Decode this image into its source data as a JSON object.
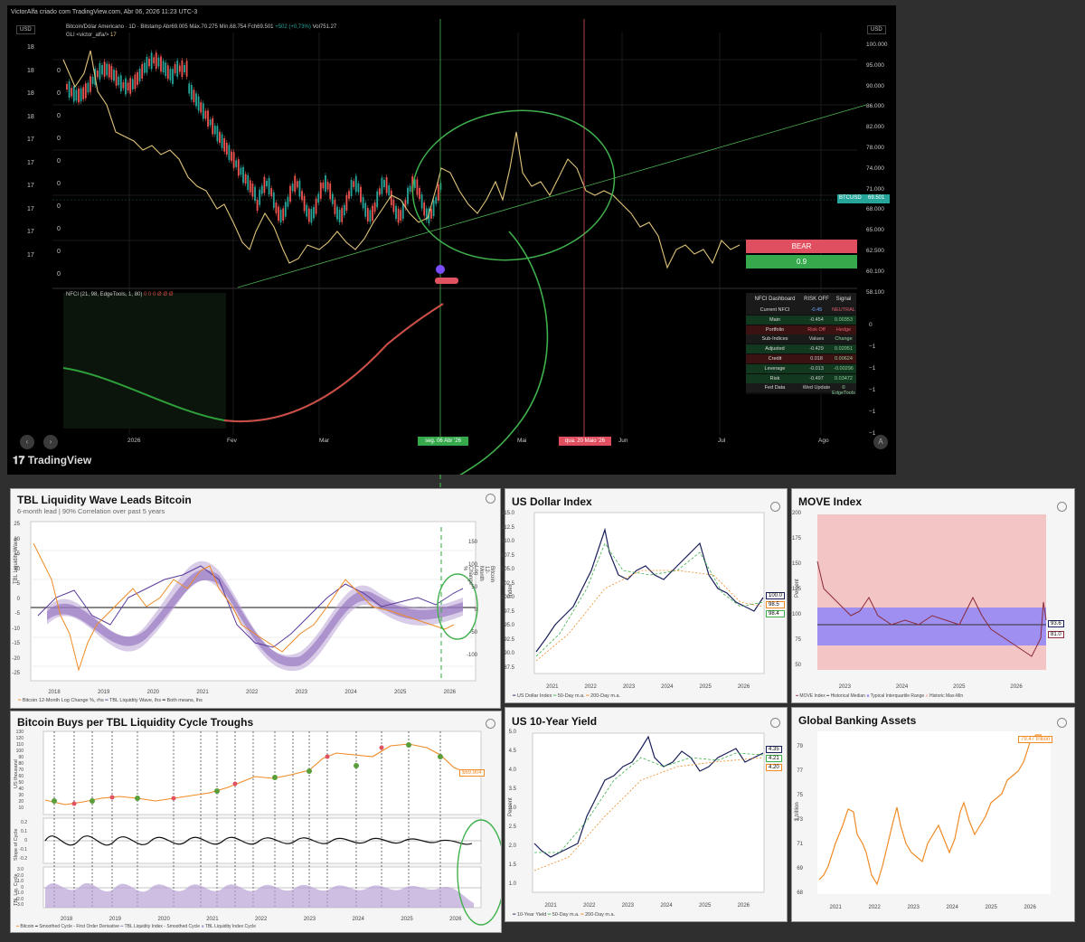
{
  "tv": {
    "header": "VictorAlfa criado com TradingView.com, Abr 06, 2026 11:23 UTC-3",
    "currency": "USD",
    "symbol_line": "Bitcoin/Dólar Americano · 1D · Bitstamp",
    "ohlc": {
      "abr": "Abr69.005",
      "max": "Máx.70.275",
      "min": "Mín.68.754",
      "fch": "Fch69.501",
      "chg": "+502 (+0,73%)",
      "vol": "Vol751.27"
    },
    "gli_line": "GLI <victor_alfa/>",
    "gli_value": "17",
    "left_axis_labels": [
      "18",
      "18",
      "18",
      "18",
      "17",
      "17",
      "17",
      "17",
      "17",
      "17"
    ],
    "left_axis_zero": [
      "0",
      "0",
      "0",
      "0",
      "0",
      "0",
      "0",
      "0",
      "0",
      "0"
    ],
    "price_axis": [
      "100.000",
      "95.000",
      "90.000",
      "86.000",
      "82.000",
      "78.000",
      "74.000",
      "71.000",
      "68.000",
      "65.000",
      "62.500",
      "60.100",
      "58.100"
    ],
    "price_tag_symbol": "BTCUSD",
    "price_tag_value": "69.501",
    "bear_label": "BEAR",
    "bear_value": "0.9",
    "nfci_label": "NFCI (21, 98, EdgeTools, 1, 80)",
    "nfci_dots": "0 0 0 Ø Ø Ø",
    "nfci_axis": [
      "0",
      "−1",
      "−1",
      "−1",
      "−1",
      "−1"
    ],
    "time_axis": [
      "2026",
      "Fev",
      "Mar",
      "Mai",
      "Jun",
      "Jul",
      "Ago"
    ],
    "green_date": "seg. 06 Abr '26",
    "red_date": "qua. 20 Maio '26",
    "logo": "TradingView",
    "dashboard": {
      "headers": [
        "NFCI Dashboard",
        "RISK OFF",
        "Signal"
      ],
      "rows": [
        {
          "name": "Current NFCI",
          "value": "-0.45",
          "signal": "NEUTRAL"
        },
        {
          "name": "Main",
          "value": "-0.454",
          "signal": "0.00353"
        },
        {
          "name": "Portfolio",
          "value": "Risk Off",
          "signal": "Hedge"
        },
        {
          "name": "Sub-Indices",
          "value": "Values",
          "signal": "Change"
        },
        {
          "name": "Adjusted",
          "value": "-0.429",
          "signal": "0.02051"
        },
        {
          "name": "Credit",
          "value": "0.018",
          "signal": "0.00624"
        },
        {
          "name": "Leverage",
          "value": "-0.013",
          "signal": "-0.00296"
        },
        {
          "name": "Risk",
          "value": "-0.497",
          "signal": "0.03472"
        },
        {
          "name": "Fed Data",
          "value": "Wed Update",
          "signal": "© EdgeTools"
        }
      ]
    }
  },
  "panels": {
    "tbl": {
      "title": "TBL Liquidity Wave Leads Bitcoin",
      "subtitle": "6-month lead | 90% Correlation over past 5 years",
      "ylabel": "TBL Liquidity Wave",
      "y2label": "Bitcoin 12-Month Log Change %",
      "yticks": [
        "25",
        "20",
        "15",
        "10",
        "5",
        "0",
        "-5",
        "-10",
        "-15",
        "-20",
        "-25"
      ],
      "y2ticks": [
        "150",
        "100",
        "50",
        "0",
        "-50",
        "-100"
      ],
      "xticks": [
        "Jan",
        "Apr",
        "Jul",
        "Oct",
        "Jan",
        "Apr",
        "Jul",
        "Oct",
        "Jan",
        "Apr",
        "Jul",
        "Oct",
        "Jan",
        "Apr",
        "Jul",
        "Oct",
        "Jan",
        "Apr",
        "Jul",
        "Oct",
        "Jan",
        "Apr",
        "Jul",
        "Oct",
        "Jan",
        "Apr",
        "Jul",
        "Oct",
        "Jan",
        "Apr",
        "Jul",
        "Oct",
        "Jan",
        "Apr",
        "Jul",
        "Oct"
      ],
      "years": [
        "2018",
        "2019",
        "2020",
        "2021",
        "2022",
        "2023",
        "2024",
        "2025",
        "2026"
      ],
      "legend": [
        "Bitcoin 12-Month Log Change %, rhs",
        "TBL Liquidity Wave, lhs",
        "Both means, lhs"
      ]
    },
    "dxy": {
      "title": "US Dollar Index",
      "ylabel": "Index",
      "yticks": [
        "115.0",
        "112.5",
        "110.0",
        "107.5",
        "105.0",
        "102.5",
        "100.0",
        "97.5",
        "95.0",
        "92.5",
        "90.0",
        "87.5"
      ],
      "xticks": [
        "May",
        "Sep",
        "Jan",
        "May",
        "Sep",
        "Jan",
        "May",
        "Sep",
        "Jan",
        "May",
        "Sep",
        "Jan",
        "May",
        "Sep",
        "Jan",
        "May"
      ],
      "years": [
        "2021",
        "2022",
        "2023",
        "2024",
        "2025",
        "2026"
      ],
      "tags": [
        "100.0",
        "98.5",
        "98.4"
      ],
      "legend": [
        "US Dollar Index",
        "50-Day m.a.",
        "200-Day m.a."
      ]
    },
    "move": {
      "title": "MOVE Index",
      "ylabel": "Percent",
      "yticks": [
        "200",
        "175",
        "150",
        "125",
        "100",
        "75",
        "50"
      ],
      "xticks": [
        "Apr",
        "Jul",
        "Oct",
        "Jan",
        "Apr",
        "Jul",
        "Oct",
        "Jan",
        "Apr",
        "Jul",
        "Oct",
        "Jan",
        "Apr"
      ],
      "years": [
        "2023",
        "2024",
        "2025",
        "2026"
      ],
      "tags": [
        "93.6",
        "81.0"
      ],
      "legend": [
        "MOVE Index",
        "Historical Median",
        "Typical Interquartile Range",
        "Historic Max-Min"
      ]
    },
    "cycle": {
      "title": "Bitcoin Buys per TBL Liquidity Cycle Troughs",
      "ylabel1": "US thousand",
      "ylabel2": "Slope of Cycle",
      "ylabel3": "TBL Liq. Cycle",
      "yticks1": [
        "130",
        "120",
        "110",
        "100",
        "90",
        "80",
        "70",
        "60",
        "50",
        "40",
        "30",
        "20",
        "10"
      ],
      "yticks2": [
        "0.2",
        "0.1",
        "0",
        "-0.1",
        "-0.2"
      ],
      "yticks3": [
        "3.0",
        "2.0",
        "1.0",
        "0",
        "-1.0",
        "-2.0",
        "-3.0"
      ],
      "tag": "$69,904",
      "xticks": [
        "Jul",
        "Nov",
        "Mar",
        "Jul",
        "Nov",
        "Mar",
        "Jul",
        "Nov",
        "Mar",
        "Jul",
        "Nov",
        "Mar",
        "Jul",
        "Nov",
        "Mar",
        "Jul",
        "Nov",
        "Mar",
        "Jul",
        "Nov",
        "Mar",
        "Jul",
        "Nov",
        "Mar",
        "Jul",
        "Nov",
        "Mar",
        "Jul",
        "Nov",
        "Mar",
        "May"
      ],
      "years": [
        "2018",
        "2019",
        "2020",
        "2021",
        "2022",
        "2023",
        "2024",
        "2025",
        "2026"
      ],
      "legend": [
        "Bitcoin",
        "Smoothed Cycle - First Order Derivative",
        "TBL Liquidity Index - Smoothed Cycle",
        "TBL Liquidity Index Cycle"
      ]
    },
    "tnx": {
      "title": "US 10-Year Yield",
      "ylabel": "Percent",
      "yticks": [
        "5.0",
        "4.5",
        "4.0",
        "3.5",
        "3.0",
        "2.5",
        "2.0",
        "1.5",
        "1.0"
      ],
      "xticks": [
        "May",
        "Sep",
        "Jan",
        "May",
        "Sep",
        "Jan",
        "May",
        "Sep",
        "Jan",
        "May",
        "Sep",
        "Jan",
        "May",
        "Sep",
        "Jan",
        "May"
      ],
      "years": [
        "2021",
        "2022",
        "2023",
        "2024",
        "2025",
        "2026"
      ],
      "tags": [
        "4.35",
        "4.21",
        "4.20"
      ],
      "legend": [
        "10-Year Yield",
        "50-Day m.a.",
        "200-Day m.a."
      ]
    },
    "gba": {
      "title": "Global Banking Assets",
      "ylabel": "$ trillion",
      "yticks": [
        "79",
        "77",
        "75",
        "73",
        "71",
        "69",
        "68"
      ],
      "xticks": [
        "May",
        "Sep",
        "Jan",
        "May",
        "Sep",
        "Jan",
        "May",
        "Sep",
        "Jan",
        "May",
        "Sep",
        "Jan",
        "May"
      ],
      "years": [
        "2021",
        "2022",
        "2023",
        "2024",
        "2025",
        "2026"
      ],
      "tag": "79.47 trillion"
    }
  },
  "chart_data": [
    {
      "type": "line",
      "title": "Bitcoin/Dólar Americano · 1D · Bitstamp",
      "ylim": [
        58100,
        100000
      ],
      "series": [
        {
          "name": "BTCUSD",
          "values": [
            88000,
            90000,
            87000,
            89000,
            92000,
            94000,
            95000,
            90000,
            86000,
            80000,
            73000,
            68000,
            70000,
            71000,
            66000,
            69000,
            68500,
            72000,
            70000,
            67000,
            69500
          ]
        },
        {
          "name": "GLI <victor_alfa/>",
          "values": [
            95000,
            90000,
            84000,
            80000,
            78000,
            76000,
            73000,
            70000,
            66000,
            68000,
            73000,
            72000,
            76000,
            74000,
            83000,
            75000,
            72000,
            70000,
            66000,
            63000,
            65000
          ]
        }
      ]
    },
    {
      "type": "line",
      "title": "TBL Liquidity Wave Leads Bitcoin",
      "x": [
        "2018",
        "2019",
        "2020",
        "2021",
        "2022",
        "2023",
        "2024",
        "2025",
        "2026"
      ],
      "series": [
        {
          "name": "Bitcoin 12-Month Log Change %, rhs",
          "values": [
            10,
            -5,
            -15,
            5,
            15,
            -10,
            -5,
            8,
            3
          ]
        },
        {
          "name": "TBL Liquidity Wave, lhs",
          "values": [
            5,
            0,
            -5,
            10,
            -10,
            -15,
            5,
            0,
            4
          ]
        }
      ]
    },
    {
      "type": "line",
      "title": "US Dollar Index",
      "x": [
        "2021",
        "2022",
        "2023",
        "2024",
        "2025",
        "2026"
      ],
      "series": [
        {
          "name": "US Dollar Index",
          "values": [
            90.5,
            96,
            112.5,
            101,
            107,
            99
          ]
        }
      ],
      "ylim": [
        87.5,
        115
      ]
    },
    {
      "type": "line",
      "title": "MOVE Index",
      "x": [
        "2023",
        "2024",
        "2025",
        "2026"
      ],
      "series": [
        {
          "name": "MOVE Index",
          "values": [
            150,
            110,
            95,
            75
          ]
        }
      ],
      "ylim": [
        50,
        200
      ]
    },
    {
      "type": "line",
      "title": "US 10-Year Yield",
      "x": [
        "2021",
        "2022",
        "2023",
        "2024",
        "2025",
        "2026"
      ],
      "series": [
        {
          "name": "10-Year Yield",
          "values": [
            1.6,
            1.8,
            4.0,
            4.2,
            4.5,
            4.3
          ]
        }
      ],
      "ylim": [
        1.0,
        5.0
      ]
    },
    {
      "type": "line",
      "title": "Global Banking Assets",
      "x": [
        "2021",
        "2022",
        "2023",
        "2024",
        "2025",
        "2026"
      ],
      "series": [
        {
          "name": "Global Banking Assets",
          "values": [
            69,
            74,
            70,
            72,
            73.5,
            79.47
          ]
        }
      ],
      "ylim": [
        68,
        79
      ]
    }
  ]
}
